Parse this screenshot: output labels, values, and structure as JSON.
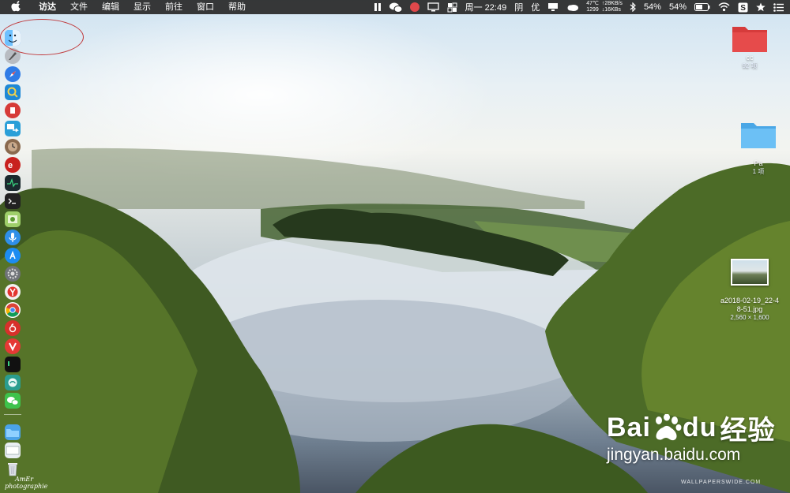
{
  "menubar": {
    "app_name": "访达",
    "menus": [
      "文件",
      "编辑",
      "显示",
      "前往",
      "窗口",
      "帮助"
    ],
    "clock": "周一 22:49",
    "weather": "阴",
    "input_method": "优",
    "net": {
      "temp": "47℃",
      "cpu": "1299",
      "up": "↑28KB/s",
      "down": "↓16KBs"
    },
    "battery_percent_1": "54%",
    "battery_percent_2": "54%",
    "wechat_badge": "5"
  },
  "dock": {
    "icons": [
      "finder-icon",
      "launchpad-icon",
      "safari-icon",
      "preview-icon",
      "dictionary-icon",
      "migration-icon",
      "clock-icon",
      "netease-icon",
      "activity-monitor-icon",
      "terminal-icon",
      "image-capture-icon",
      "siri-icon",
      "app-store-icon",
      "system-preferences-icon",
      "yandex-icon",
      "chrome-icon",
      "netease-music-icon",
      "vivaldi-icon",
      "iterm-icon",
      "cloud-app-icon",
      "wechat-icon",
      "folder-icon",
      "desktop-icon",
      "trash-icon"
    ]
  },
  "desktop": {
    "items": [
      {
        "name": "cc",
        "sub": "92 项"
      },
      {
        "name": "Pa",
        "sub": "1 项"
      },
      {
        "name": "a2018-02-19_22-48-51.jpg",
        "name_line1": "a2018-02-19_22-4",
        "name_line2": "8-51.jpg",
        "sub": "2,560 × 1,600"
      }
    ]
  },
  "watermark": {
    "baidu_logo": "Bai",
    "baidu_logo2": "du",
    "baidu_cn": "经验",
    "baidu_url": "jingyan.baidu.com",
    "wallpaperswide": "WALLPAPERSWIDE.COM",
    "signature_1": "AmEr",
    "signature_2": "photographie"
  },
  "colors": {
    "annotation": "#c0393b",
    "menubar": "#282828",
    "folder_red": "#e64b4b",
    "folder_blue": "#5ab4f0"
  }
}
